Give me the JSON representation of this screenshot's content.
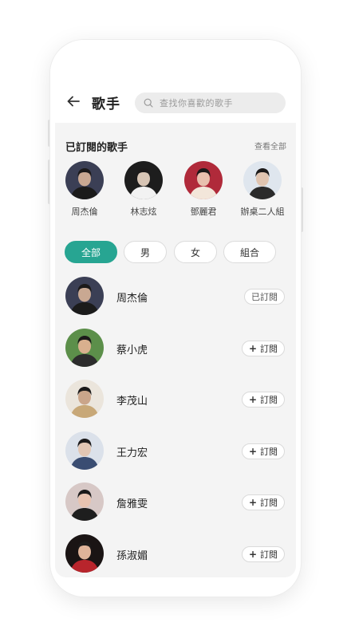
{
  "header": {
    "title": "歌手",
    "search_placeholder": "查找你喜歡的歌手"
  },
  "subscribed": {
    "title": "已訂閱的歌手",
    "see_all": "查看全部",
    "items": [
      {
        "name": "周杰倫",
        "bg": "#3b3f55",
        "face": "#c9a892",
        "shirt": "#1b1b1b"
      },
      {
        "name": "林志炫",
        "bg": "#1d1d1d",
        "face": "#d8c5b5",
        "shirt": "#f2f2f2"
      },
      {
        "name": "鄧麗君",
        "bg": "#b02a3a",
        "face": "#e8c0ae",
        "shirt": "#f3e6da"
      },
      {
        "name": "辦桌二人組",
        "bg": "#dfe6ee",
        "face": "#e0c4b0",
        "shirt": "#2b2b2b"
      }
    ]
  },
  "filters": [
    "全部",
    "男",
    "女",
    "組合"
  ],
  "singers": [
    {
      "name": "周杰倫",
      "button": "已訂閱",
      "subscribed": true,
      "bg": "#3b3f55",
      "face": "#c9a892",
      "shirt": "#1b1b1b"
    },
    {
      "name": "蔡小虎",
      "button": "訂閱",
      "subscribed": false,
      "bg": "#5c8f4a",
      "face": "#d9b08e",
      "shirt": "#2c2c2c"
    },
    {
      "name": "李茂山",
      "button": "訂閱",
      "subscribed": false,
      "bg": "#ebe5dc",
      "face": "#caa58a",
      "shirt": "#c8a878"
    },
    {
      "name": "王力宏",
      "button": "訂閱",
      "subscribed": false,
      "bg": "#dbe1ea",
      "face": "#e2c6b3",
      "shirt": "#3a4d72"
    },
    {
      "name": "詹雅雯",
      "button": "訂閱",
      "subscribed": false,
      "bg": "#d7c8c6",
      "face": "#e8c3b0",
      "shirt": "#1e1e1e"
    },
    {
      "name": "孫淑媚",
      "button": "訂閱",
      "subscribed": false,
      "bg": "#1a1414",
      "face": "#e0b49a",
      "shirt": "#b8252c"
    }
  ]
}
